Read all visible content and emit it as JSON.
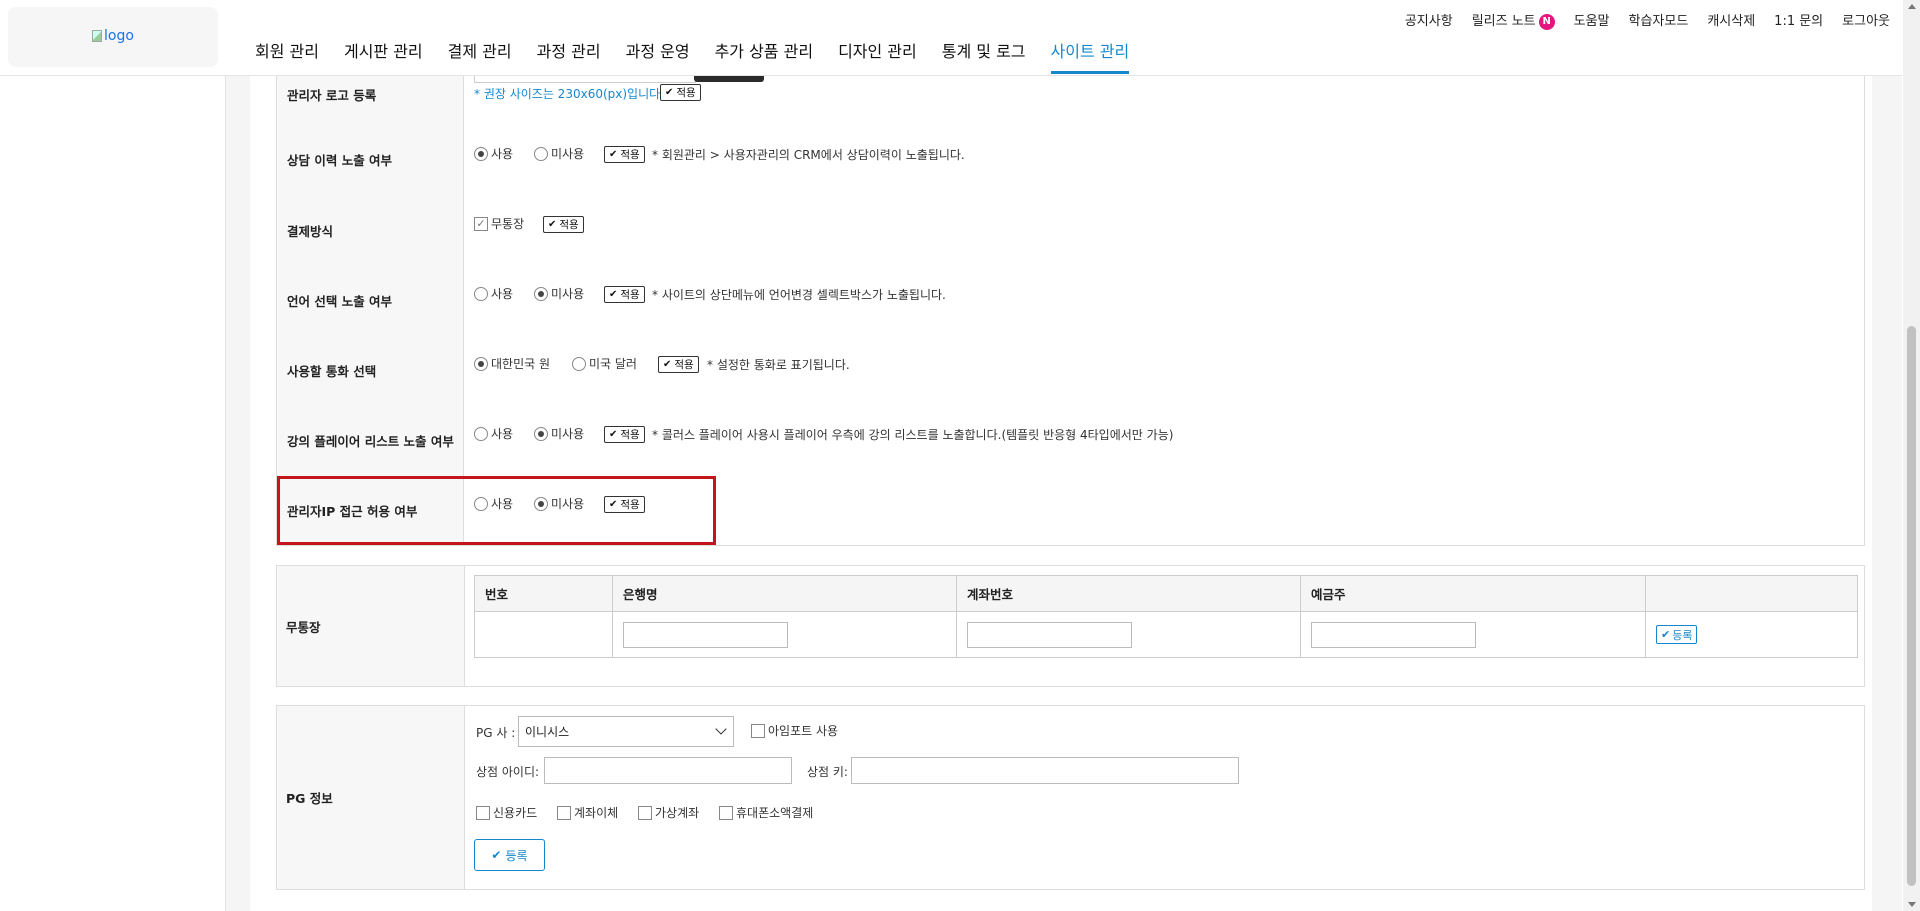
{
  "header": {
    "logo_alt": "logo",
    "top_links": [
      {
        "label": "공지사항"
      },
      {
        "label": "릴리즈 노트",
        "badge": "N"
      },
      {
        "label": "도움말"
      },
      {
        "label": "학습자모드"
      },
      {
        "label": "캐시삭제"
      },
      {
        "label": "1:1 문의"
      },
      {
        "label": "로그아웃"
      }
    ],
    "nav": [
      {
        "label": "회원 관리"
      },
      {
        "label": "게시판 관리"
      },
      {
        "label": "결제 관리"
      },
      {
        "label": "과정 관리"
      },
      {
        "label": "과정 운영"
      },
      {
        "label": "추가 상품 관리"
      },
      {
        "label": "디자인 관리"
      },
      {
        "label": "통계 및 로그"
      },
      {
        "label": "사이트 관리",
        "active": true
      }
    ]
  },
  "apply_label": "적용",
  "settings": {
    "admin_logo": {
      "label": "관리자 로고 등록",
      "note": "* 권장 사이즈는 230x60(px)입니다."
    },
    "consult_history": {
      "label": "상담 이력 노출 여부",
      "opt_on": "사용",
      "opt_off": "미사용",
      "selected": "사용",
      "note": "* 회원관리 > 사용자관리의 CRM에서 상담이력이 노출됩니다."
    },
    "payment_method": {
      "label": "결제방식",
      "option": "무통장",
      "checked": true
    },
    "language_select": {
      "label": "언어 선택 노출 여부",
      "opt_on": "사용",
      "opt_off": "미사용",
      "selected": "미사용",
      "note": "* 사이트의 상단메뉴에 언어변경 셀렉트박스가 노출됩니다."
    },
    "currency": {
      "label": "사용할 통화 선택",
      "opt_krw": "대한민국 원",
      "opt_usd": "미국 달러",
      "selected": "대한민국 원",
      "note": "* 설정한 통화로 표기됩니다."
    },
    "player_list": {
      "label": "강의 플레이어 리스트 노출 여부",
      "opt_on": "사용",
      "opt_off": "미사용",
      "selected": "미사용",
      "note": "* 콜러스 플레이어 사용시 플레이어 우측에 강의 리스트를 노출합니다.(템플릿 반응형 4타입에서만 가능)"
    },
    "admin_ip": {
      "label": "관리자IP 접근 허용 여부",
      "opt_on": "사용",
      "opt_off": "미사용",
      "selected": "미사용"
    }
  },
  "bank": {
    "label": "무통장",
    "columns": [
      "번호",
      "은행명",
      "계좌번호",
      "예금주",
      ""
    ],
    "register_label": "등록"
  },
  "pg": {
    "label": "PG 정보",
    "company_label": "PG 사 :",
    "company_value": "이니시스",
    "iamport_label": "아임포트 사용",
    "merchant_id_label": "상점 아이디:",
    "merchant_key_label": "상점 키:",
    "methods": [
      "신용카드",
      "계좌이체",
      "가상계좌",
      "휴대폰소액결제"
    ],
    "register_label": "등록"
  }
}
